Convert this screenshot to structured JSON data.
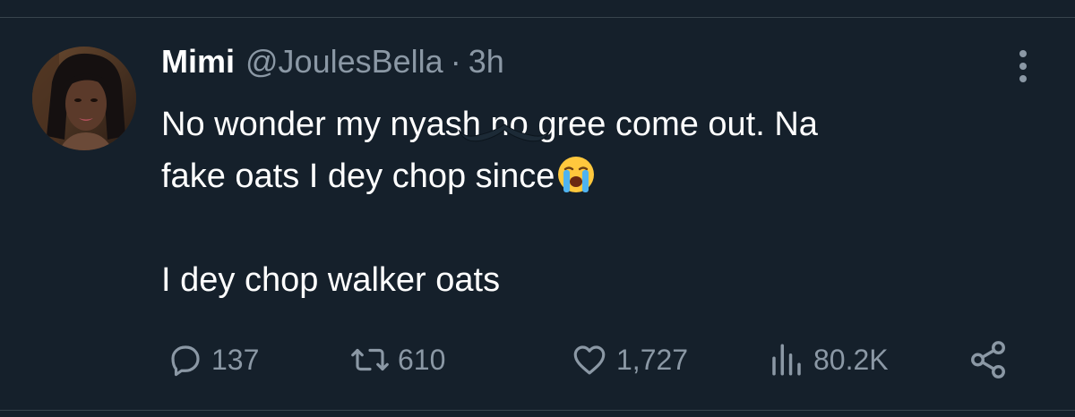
{
  "author": {
    "name": "Mimi",
    "handle": "@JoulesBella",
    "separator": "·",
    "time": "3h"
  },
  "tweet": {
    "line1": "No wonder my nyash no gree come out. Na",
    "line2": "fake oats I dey chop since",
    "line3": "I dey chop walker oats",
    "emoji": "loudly-crying-face-emoji",
    "overlay": "mustache-sticker"
  },
  "stats": {
    "replies": "137",
    "reposts": "610",
    "likes": "1,727",
    "views": "80.2K"
  },
  "icons": {
    "replies": "reply-icon",
    "reposts": "repost-icon",
    "likes": "heart-icon",
    "views": "views-icon",
    "share": "share-icon",
    "more": "more-options-icon"
  },
  "colors": {
    "background": "#15202b",
    "text": "#ffffff",
    "muted": "#8b98a5",
    "divider": "#38444d"
  }
}
